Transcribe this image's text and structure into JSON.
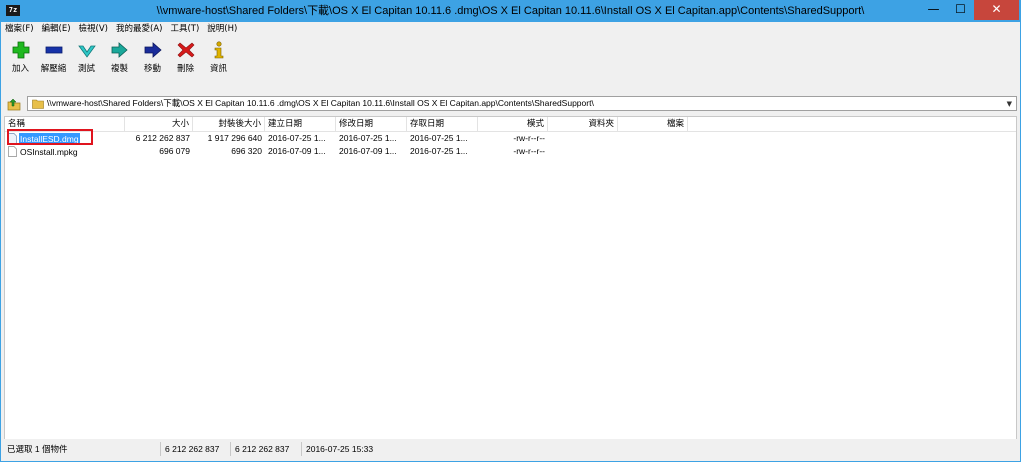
{
  "window": {
    "app_icon_text": "7z",
    "title": "\\\\vmware-host\\Shared Folders\\下載\\OS X El Capitan 10.11.6 .dmg\\OS X El Capitan 10.11.6\\Install OS X El Capitan.app\\Contents\\SharedSupport\\",
    "minimize": "—",
    "maximize": "☐",
    "close": "✕"
  },
  "menu": [
    "檔案(F)",
    "編輯(E)",
    "檢視(V)",
    "我的最愛(A)",
    "工具(T)",
    "說明(H)"
  ],
  "toolbar": [
    {
      "label": "加入",
      "icon": "plus-icon"
    },
    {
      "label": "解壓縮",
      "icon": "minus-icon"
    },
    {
      "label": "測試",
      "icon": "check-icon"
    },
    {
      "label": "複製",
      "icon": "double-arrow-icon"
    },
    {
      "label": "移動",
      "icon": "arrow-right-icon"
    },
    {
      "label": "刪除",
      "icon": "delete-x-icon"
    },
    {
      "label": "資訊",
      "icon": "info-icon"
    }
  ],
  "address": {
    "path": "\\\\vmware-host\\Shared Folders\\下載\\OS X El Capitan 10.11.6 .dmg\\OS X El Capitan 10.11.6\\Install OS X El Capitan.app\\Contents\\SharedSupport\\",
    "dropdown": "▼"
  },
  "columns": {
    "name": "名稱",
    "size": "大小",
    "packed": "封裝後大小",
    "created": "建立日期",
    "modified": "修改日期",
    "accessed": "存取日期",
    "mode": "模式",
    "folders": "資料夾",
    "files": "檔案"
  },
  "rows": [
    {
      "name": "InstallESD.dmg",
      "size": "6 212 262 837",
      "packed": "1 917 296 640",
      "created": "2016-07-25 1...",
      "modified": "2016-07-25 1...",
      "accessed": "2016-07-25 1...",
      "mode": "-rw-r--r--",
      "selected": true
    },
    {
      "name": "OSInstall.mpkg",
      "size": "696 079",
      "packed": "696 320",
      "created": "2016-07-09 1...",
      "modified": "2016-07-09 1...",
      "accessed": "2016-07-25 1...",
      "mode": "-rw-r--r--",
      "selected": false
    }
  ],
  "status": {
    "selection": "已選取 1 個物件",
    "size": "6 212 262 837",
    "packed": "6 212 262 837",
    "date": "2016-07-25 15:33"
  },
  "colors": {
    "title_bar": "#3da2e4",
    "selection": "#3399ff",
    "highlight": "#e0141e"
  }
}
